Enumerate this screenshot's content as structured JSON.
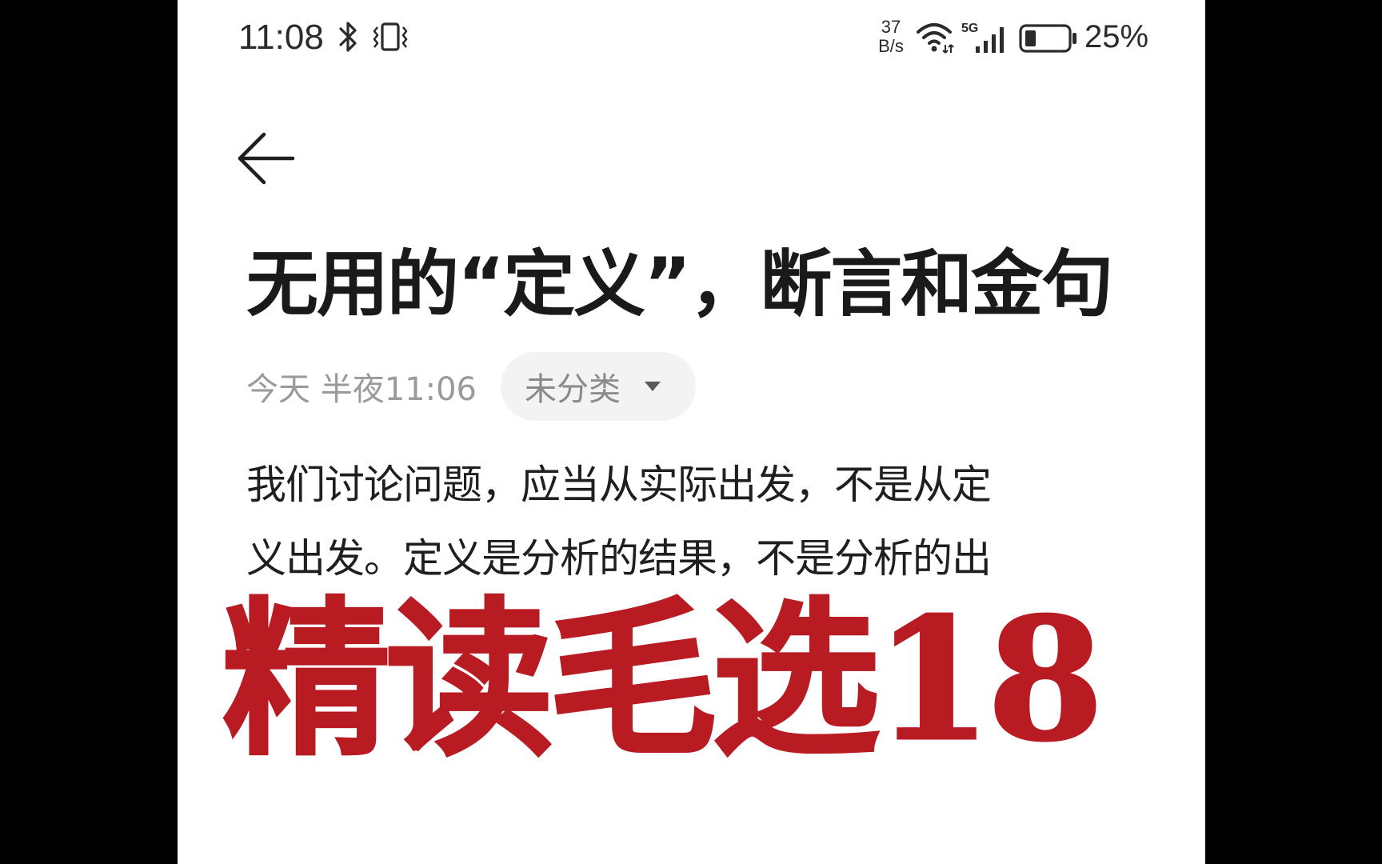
{
  "status_bar": {
    "time": "11:08",
    "bluetooth_icon": "bluetooth-icon",
    "vibrate_icon": "vibrate-icon",
    "net_speed_value": "37",
    "net_speed_unit": "B/s",
    "wifi_icon": "wifi-icon",
    "network_type": "5G",
    "signal_icon": "signal-icon",
    "battery_icon": "battery-icon",
    "battery_level": 0.25,
    "battery_percent": "25%"
  },
  "toolbar": {
    "back_icon": "back-arrow-icon"
  },
  "note": {
    "title": "无用的“定义”，断言和金句",
    "date": "今天 半夜11:06",
    "category": "未分类",
    "category_dropdown_icon": "caret-down-icon",
    "body_lines": [
      "我们讨论问题，应当从实际出发，不是从定",
      "义出发。定义是分析的结果，不是分析的出"
    ]
  },
  "overlay": {
    "caption": "精读毛选18"
  },
  "colors": {
    "background": "#ffffff",
    "letterbox": "#000000",
    "text_primary": "#1a1a1a",
    "text_secondary": "#9a9a9a",
    "pill_background": "#f3f3f3",
    "overlay_red": "#b81c22"
  }
}
